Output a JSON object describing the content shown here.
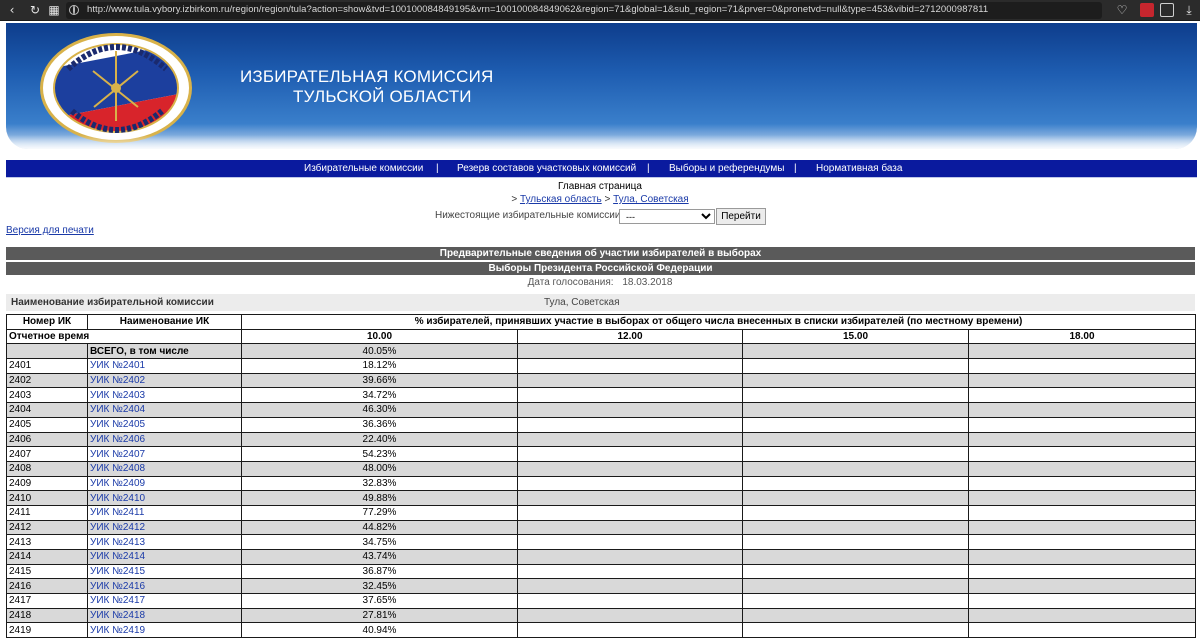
{
  "browser": {
    "url": "http://www.tula.vybory.izbirkom.ru/region/region/tula?action=show&tvd=100100084849195&vrn=100100084849062&region=71&global=1&sub_region=71&prver=0&pronetvd=null&type=453&vibid=2712000987811"
  },
  "header": {
    "title_line1": "ИЗБИРАТЕЛЬНАЯ КОМИССИЯ",
    "title_line2": "ТУЛЬСКОЙ ОБЛАСТИ"
  },
  "menu": {
    "items": [
      "Избирательные комиссии",
      "Резерв составов участковых комиссий",
      "Выборы и референдумы",
      "Нормативная база"
    ],
    "separator": "|"
  },
  "page": {
    "home": "Главная страница",
    "crumb_prefix": ">",
    "crumb1": "Тульская область",
    "crumb2": "Тула, Советская",
    "lower_label": "Нижестоящие избирательные комиссии:",
    "lower_selected": "---",
    "go_label": "Перейти",
    "print_label": "Версия для печати",
    "bar1": "Предварительные сведения об участии избирателей в выборах",
    "bar2": "Выборы Президента Российской Федерации",
    "date_label": "Дата голосования:",
    "date_value": "18.03.2018",
    "commission_label": "Наименование избирательной комиссии",
    "commission_value": "Тула, Советская"
  },
  "table": {
    "col_number": "Номер ИК",
    "col_name": "Наименование ИК",
    "col_turnout": "% избирателей, принявших участие в выборах от общего числа внесенных в списки избирателей (по местному времени)",
    "report_time": "Отчетное время",
    "times": [
      "10.00",
      "12.00",
      "15.00",
      "18.00"
    ],
    "total_label": "ВСЕГО, в том числе",
    "total_value": "40.05%",
    "rows": [
      {
        "num": "2401",
        "name": "УИК №2401",
        "v10": "18.12%"
      },
      {
        "num": "2402",
        "name": "УИК №2402",
        "v10": "39.66%"
      },
      {
        "num": "2403",
        "name": "УИК №2403",
        "v10": "34.72%"
      },
      {
        "num": "2404",
        "name": "УИК №2404",
        "v10": "46.30%"
      },
      {
        "num": "2405",
        "name": "УИК №2405",
        "v10": "36.36%"
      },
      {
        "num": "2406",
        "name": "УИК №2406",
        "v10": "22.40%"
      },
      {
        "num": "2407",
        "name": "УИК №2407",
        "v10": "54.23%"
      },
      {
        "num": "2408",
        "name": "УИК №2408",
        "v10": "48.00%"
      },
      {
        "num": "2409",
        "name": "УИК №2409",
        "v10": "32.83%"
      },
      {
        "num": "2410",
        "name": "УИК №2410",
        "v10": "49.88%"
      },
      {
        "num": "2411",
        "name": "УИК №2411",
        "v10": "77.29%"
      },
      {
        "num": "2412",
        "name": "УИК №2412",
        "v10": "44.82%"
      },
      {
        "num": "2413",
        "name": "УИК №2413",
        "v10": "34.75%"
      },
      {
        "num": "2414",
        "name": "УИК №2414",
        "v10": "43.74%"
      },
      {
        "num": "2415",
        "name": "УИК №2415",
        "v10": "36.87%"
      },
      {
        "num": "2416",
        "name": "УИК №2416",
        "v10": "32.45%"
      },
      {
        "num": "2417",
        "name": "УИК №2417",
        "v10": "37.65%"
      },
      {
        "num": "2418",
        "name": "УИК №2418",
        "v10": "27.81%"
      },
      {
        "num": "2419",
        "name": "УИК №2419",
        "v10": "40.94%"
      }
    ]
  },
  "colors": {
    "menu_bg": "#0a1a9e",
    "bar_bg": "#5a5a5a",
    "link": "#1a3aa8",
    "row_alt": "#d9d9d9"
  },
  "icons": {
    "back": "arrow-left-icon",
    "reload": "reload-icon",
    "tabs": "grid-icon",
    "site": "globe-icon",
    "bookmark": "heart-icon"
  }
}
